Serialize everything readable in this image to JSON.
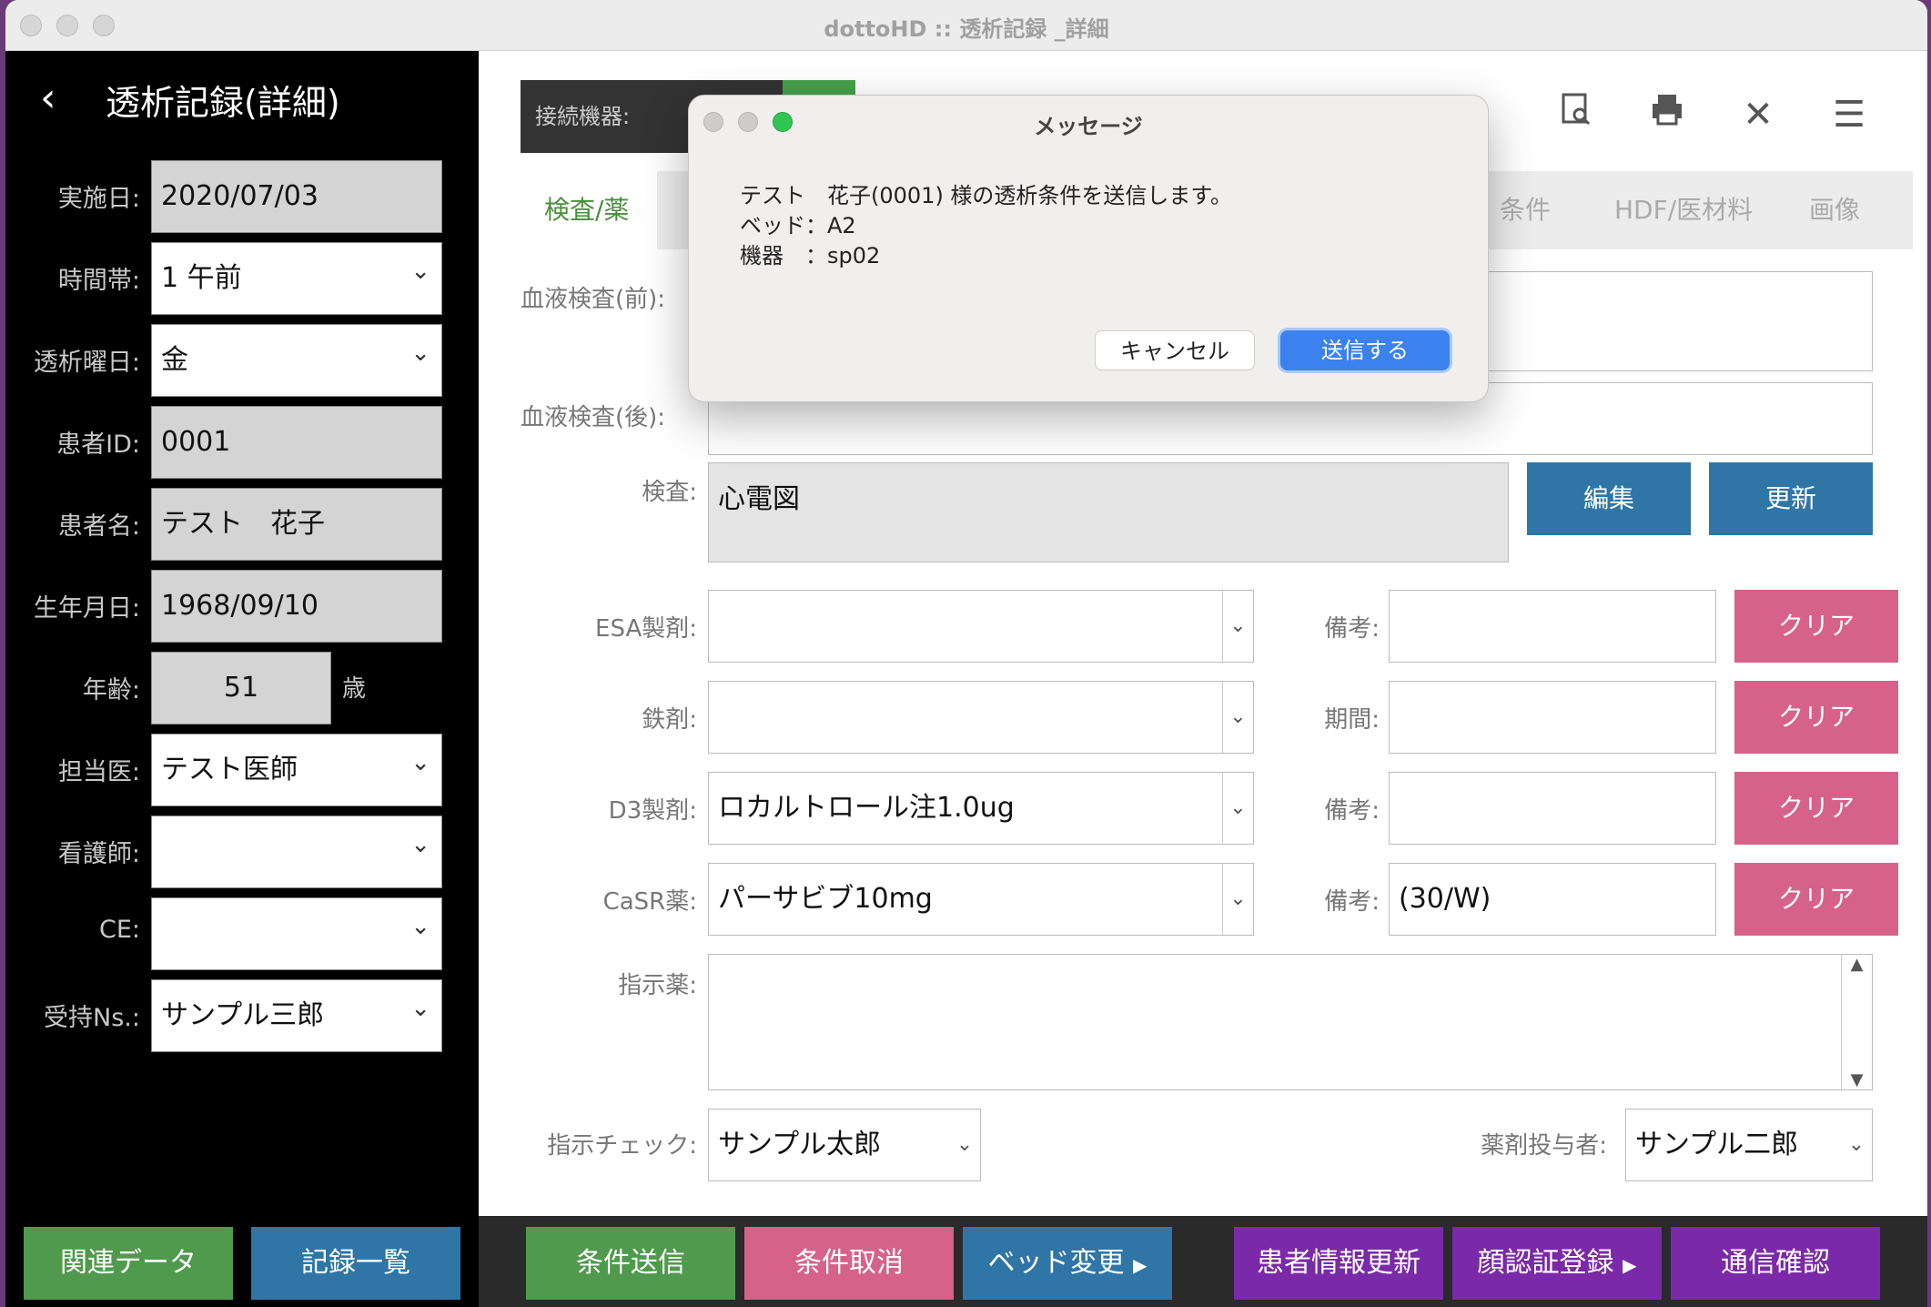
{
  "window": {
    "title": "dottoHD :: 透析記録 _詳細"
  },
  "sidebar": {
    "title": "透析記録(詳細)",
    "fields": [
      {
        "label": "実施日:",
        "value": "2020/07/03"
      },
      {
        "label": "時間帯:",
        "value": "1 午前"
      },
      {
        "label": "透析曜日:",
        "value": "金"
      },
      {
        "label": "患者ID:",
        "value": "0001"
      },
      {
        "label": "患者名:",
        "value": "テスト　花子"
      },
      {
        "label": "生年月日:",
        "value": "1968/09/10"
      },
      {
        "label": "年齢:",
        "value": "51",
        "suffix": "歳"
      },
      {
        "label": "担当医:",
        "value": "テスト医師"
      },
      {
        "label": "看護師:",
        "value": ""
      },
      {
        "label": "CE:",
        "value": ""
      },
      {
        "label": "受持Ns.:",
        "value": "サンプル三郎"
      }
    ],
    "buttons": [
      "関連データ",
      "記録一覧"
    ]
  },
  "toolbar": {
    "connected_label": "接続機器:"
  },
  "tabs": [
    "検査/薬",
    "条件",
    "HDF/医材料",
    "画像"
  ],
  "form": {
    "blood_pre_label": "血液検査(前):",
    "blood_post_label": "血液検査(後):",
    "exam_label": "検査:",
    "exam_value": "心電図",
    "edit_button": "編集",
    "update_button": "更新",
    "rows": [
      {
        "label": "ESA製剤:",
        "value": "",
        "note_label": "備考:",
        "note": "",
        "clear": "クリア"
      },
      {
        "label": "鉄剤:",
        "value": "",
        "note_label": "期間:",
        "note": "",
        "clear": "クリア"
      },
      {
        "label": "D3製剤:",
        "value": "ロカルトロール注1.0ug",
        "note_label": "備考:",
        "note": "",
        "clear": "クリア"
      },
      {
        "label": "CaSR薬:",
        "value": "パーサビブ10mg",
        "note_label": "備考:",
        "note": "(30/W)",
        "clear": "クリア"
      }
    ],
    "instruction_label": "指示薬:",
    "check_label": "指示チェック:",
    "check_value": "サンプル太郎",
    "admin_label": "薬剤投与者:",
    "admin_value": "サンプル二郎"
  },
  "footer": {
    "buttons": [
      "条件送信",
      "条件取消",
      "ベッド変更",
      "患者情報更新",
      "顔認証登録",
      "通信確認"
    ]
  },
  "dialog": {
    "title": "メッセージ",
    "line1": "テスト　花子(0001) 様の透析条件を送信します。",
    "line2": "ベッド：A2",
    "line3": "機器　：sp02",
    "cancel": "キャンセル",
    "ok": "送信する"
  },
  "colors": {
    "green": "#4f9a4c",
    "blue": "#2f76a6",
    "pink": "#d6628a",
    "purple": "#7a2aa8"
  }
}
